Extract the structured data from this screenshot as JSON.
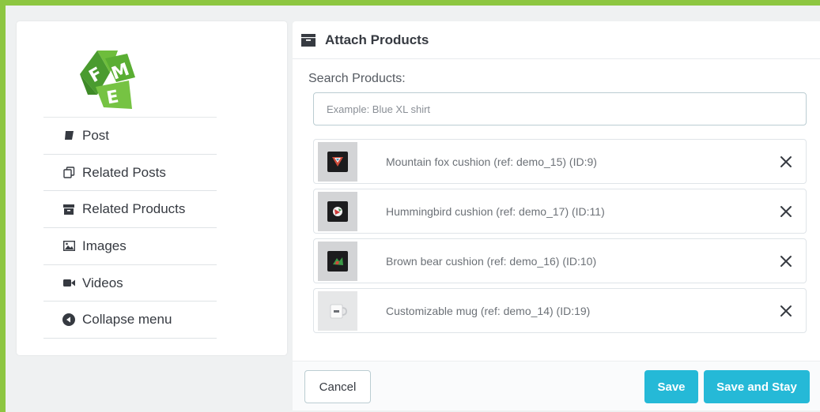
{
  "sidebar": {
    "items": [
      {
        "label": "Post",
        "icon": "book-icon"
      },
      {
        "label": "Related Posts",
        "icon": "copy-icon"
      },
      {
        "label": "Related Products",
        "icon": "archive-icon"
      },
      {
        "label": "Images",
        "icon": "image-icon"
      },
      {
        "label": "Videos",
        "icon": "video-camera-icon"
      },
      {
        "label": "Collapse menu",
        "icon": "circle-chevron-left-icon"
      }
    ]
  },
  "panel": {
    "title": "Attach Products",
    "search": {
      "label": "Search Products:",
      "value": "",
      "placeholder": "Example: Blue XL shirt"
    },
    "products": [
      {
        "name": "Mountain fox cushion (ref: demo_15) (ID:9)",
        "thumb": "fox-cushion"
      },
      {
        "name": "Hummingbird cushion (ref: demo_17) (ID:11)",
        "thumb": "hummingbird-cushion"
      },
      {
        "name": "Brown bear cushion (ref: demo_16) (ID:10)",
        "thumb": "bear-cushion"
      },
      {
        "name": "Customizable mug (ref: demo_14) (ID:19)",
        "thumb": "mug"
      }
    ]
  },
  "footer": {
    "cancel_label": "Cancel",
    "save_label": "Save",
    "save_stay_label": "Save and Stay"
  },
  "colors": {
    "frame": "#8dc641",
    "primary": "#25b9d7",
    "background": "#eff1f2"
  }
}
